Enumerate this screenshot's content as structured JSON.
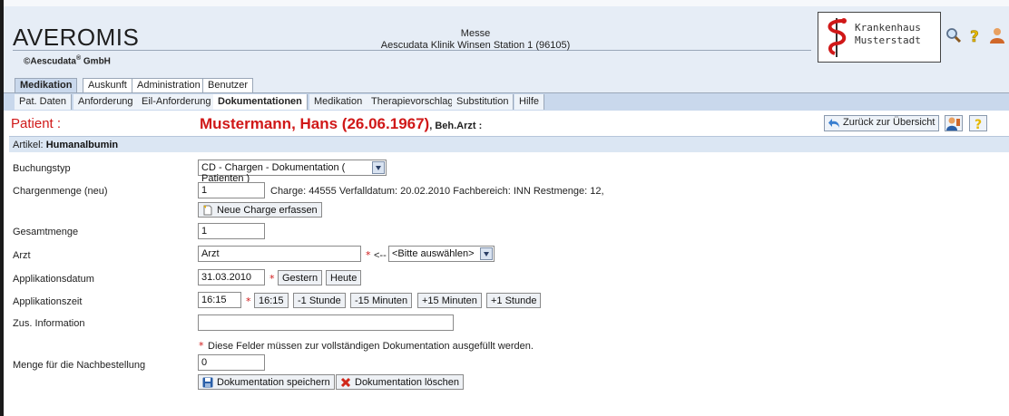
{
  "header": {
    "brand": "AVEROMIS",
    "copyright_name": "©Aescudata",
    "copyright_sup": "®",
    "copyright_suffix": " GmbH",
    "location_line1": "Messe",
    "location_line2": "Aescudata Klinik Winsen Station 1 (96105)",
    "hospital_line1": "Krankenhaus",
    "hospital_line2": "Musterstadt"
  },
  "main_tabs": [
    {
      "label": "Medikation",
      "active": true
    },
    {
      "label": "Auskunft",
      "active": false
    },
    {
      "label": "Administration",
      "active": false
    },
    {
      "label": "Benutzer",
      "active": false
    }
  ],
  "sub_tabs": [
    {
      "label": "Pat. Daten",
      "active": false
    },
    {
      "label": "Anforderung",
      "active": false
    },
    {
      "label": "Eil-Anforderung",
      "active": false
    },
    {
      "label": "Dokumentationen",
      "active": true
    },
    {
      "label": "Medikation",
      "active": false
    },
    {
      "label": "Therapievorschlag",
      "active": false
    },
    {
      "label": "Substitution",
      "active": false
    },
    {
      "label": "Hilfe",
      "active": false
    }
  ],
  "patient": {
    "label": "Patient :",
    "name": "Mustermann, Hans (26.06.1967)",
    "beh_arzt": ", Beh.Arzt :",
    "back_label": "Zurück zur Übersicht"
  },
  "artikel": {
    "prefix": "Artikel: ",
    "name": "Humanalbumin"
  },
  "form": {
    "buchungstyp_label": "Buchungstyp",
    "buchungstyp_value": "CD - Chargen - Dokumentation ( Patienten )",
    "chargenmenge_label": "Chargenmenge (neu)",
    "chargenmenge_value": "1",
    "charge_info": "Charge: 44555 Verfalldatum: 20.02.2010 Fachbereich: INN Restmenge: 12,",
    "neue_charge_label": "Neue Charge erfassen",
    "gesamtmenge_label": "Gesamtmenge",
    "gesamtmenge_value": "1",
    "arzt_label": "Arzt",
    "arzt_value": "Arzt",
    "arzt_arrow": "<--",
    "arzt_select": "<Bitte auswählen>",
    "applikationsdatum_label": "Applikationsdatum",
    "applikationsdatum_value": "31.03.2010",
    "gestern_label": "Gestern",
    "heute_label": "Heute",
    "applikationszeit_label": "Applikationszeit",
    "applikationszeit_value": "16:15",
    "time_buttons": [
      "16:15",
      "-1 Stunde",
      "-15 Minuten",
      "+15 Minuten",
      "+1 Stunde"
    ],
    "zus_info_label": "Zus. Information",
    "zus_info_value": "",
    "required_note": "Diese Felder müssen zur vollständigen Dokumentation ausgefüllt werden.",
    "nachbestellung_label": "Menge für die Nachbestellung",
    "nachbestellung_value": "0",
    "save_label": "Dokumentation speichern",
    "delete_label": "Dokumentation löschen"
  },
  "colors": {
    "patient_red": "#d01818",
    "header_bg": "#e6edf6",
    "tab_bar_bg": "#c9d8ec"
  }
}
